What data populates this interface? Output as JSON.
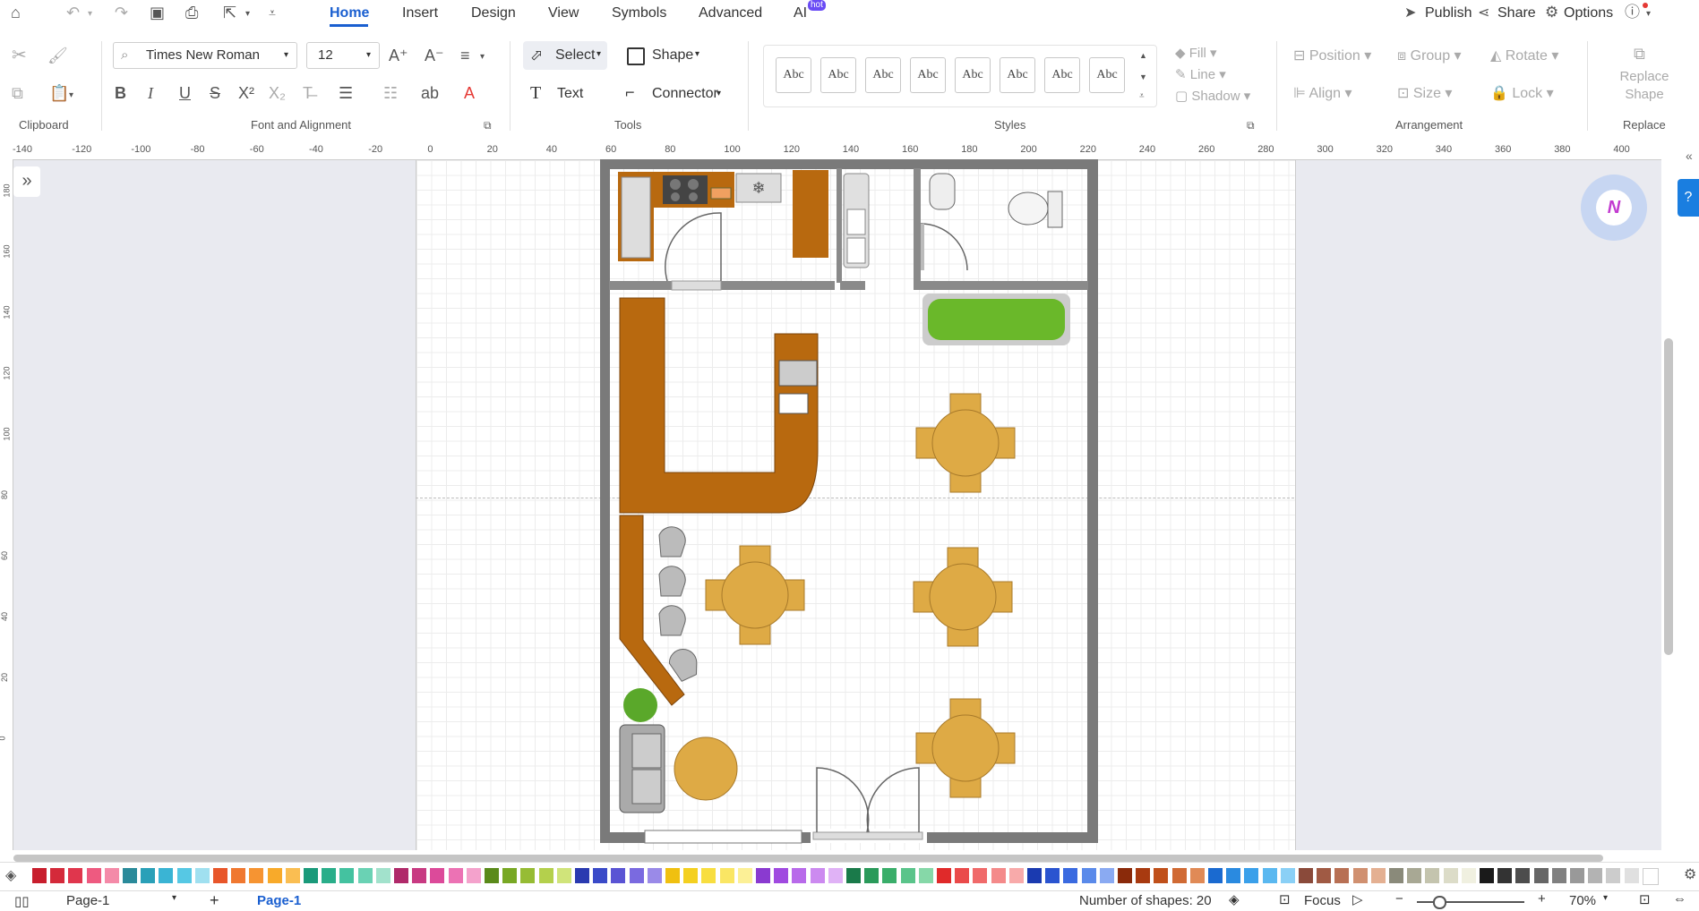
{
  "menu": {
    "tabs": [
      "Home",
      "Insert",
      "Design",
      "View",
      "Symbols",
      "Advanced",
      "AI"
    ],
    "ai_badge": "hot",
    "publish": "Publish",
    "share": "Share",
    "options": "Options"
  },
  "ribbon": {
    "font_family": "Times New Roman",
    "font_size": "12",
    "select_label": "Select",
    "shape_label": "Shape",
    "text_label": "Text",
    "connector_label": "Connector",
    "style_sample": "Abc",
    "fill": "Fill",
    "line": "Line",
    "shadow": "Shadow",
    "position": "Position",
    "group": "Group",
    "rotate": "Rotate",
    "align": "Align",
    "size": "Size",
    "lock": "Lock",
    "replace_shape_1": "Replace",
    "replace_shape_2": "Shape",
    "groups": {
      "clipboard": "Clipboard",
      "font": "Font and Alignment",
      "tools": "Tools",
      "styles": "Styles",
      "arrangement": "Arrangement",
      "replace": "Replace"
    }
  },
  "ruler": {
    "h_ticks": [
      "-140",
      "-120",
      "-100",
      "-80",
      "-60",
      "-40",
      "-20",
      "0",
      "20",
      "40",
      "60",
      "80",
      "100",
      "120",
      "140",
      "160",
      "180",
      "200",
      "220",
      "240",
      "260",
      "280",
      "300",
      "320",
      "340",
      "360",
      "380",
      "400"
    ],
    "v_ticks": [
      "180",
      "160",
      "140",
      "120",
      "100",
      "80",
      "60",
      "40",
      "20",
      "0"
    ]
  },
  "status": {
    "page_selector": "Page-1",
    "page_tab": "Page-1",
    "shapes_count": "Number of shapes: 20",
    "focus": "Focus",
    "zoom": "70%"
  },
  "palette": [
    "#c81e2d",
    "#d42a3a",
    "#e0364d",
    "#ee5a80",
    "#f48aa8",
    "#2a8a9a",
    "#2aa0b8",
    "#3ab4d4",
    "#56c8e4",
    "#a0e0f0",
    "#e8562a",
    "#f07830",
    "#f69432",
    "#f8aa2a",
    "#fabe52",
    "#1a9a7a",
    "#2aae8a",
    "#44c2a0",
    "#6ad2b4",
    "#a2e2cc",
    "#b02a6a",
    "#c83a82",
    "#dc4a9a",
    "#ec72b4",
    "#f4a2cc",
    "#5a8a1a",
    "#78a824",
    "#96bc34",
    "#b4d04c",
    "#d0e47a",
    "#2a3ab0",
    "#3a4ac8",
    "#5a54d4",
    "#7a6ae0",
    "#9a8ae8",
    "#f0c010",
    "#f4d020",
    "#f8de40",
    "#fae664",
    "#fcf096",
    "#8a3ad0",
    "#a04ae0",
    "#b86aea",
    "#cc8af0",
    "#e0b2f6",
    "#1a7a4a",
    "#2a9a5a",
    "#3aae6a",
    "#5ac48a",
    "#86d8a8",
    "#e02a2a",
    "#ea4a4a",
    "#f06a6a",
    "#f48a8a",
    "#f8aaaa",
    "#1a3ab0",
    "#2a54d0",
    "#3a6ae0",
    "#5a8aea",
    "#8aaaf2",
    "#8a2a0a",
    "#a83a10",
    "#c0501a",
    "#d06a34",
    "#e08a56",
    "#1a6ad0",
    "#2a8ae0",
    "#3aa0ea",
    "#5ab8f0",
    "#8ad0f6",
    "#8a4a3a",
    "#a05a44",
    "#b87054",
    "#d09070",
    "#e4b092",
    "#8a8a7a",
    "#a8a894",
    "#c4c4ae",
    "#dcdcc8",
    "#f0f0e0",
    "#1a1a1a",
    "#333333",
    "#4d4d4d",
    "#666666",
    "#808080",
    "#999999",
    "#b3b3b3",
    "#cccccc",
    "#e0e0e0",
    "#ffffff"
  ],
  "floorplan": {
    "shapes_desc": "restaurant floor plan"
  }
}
